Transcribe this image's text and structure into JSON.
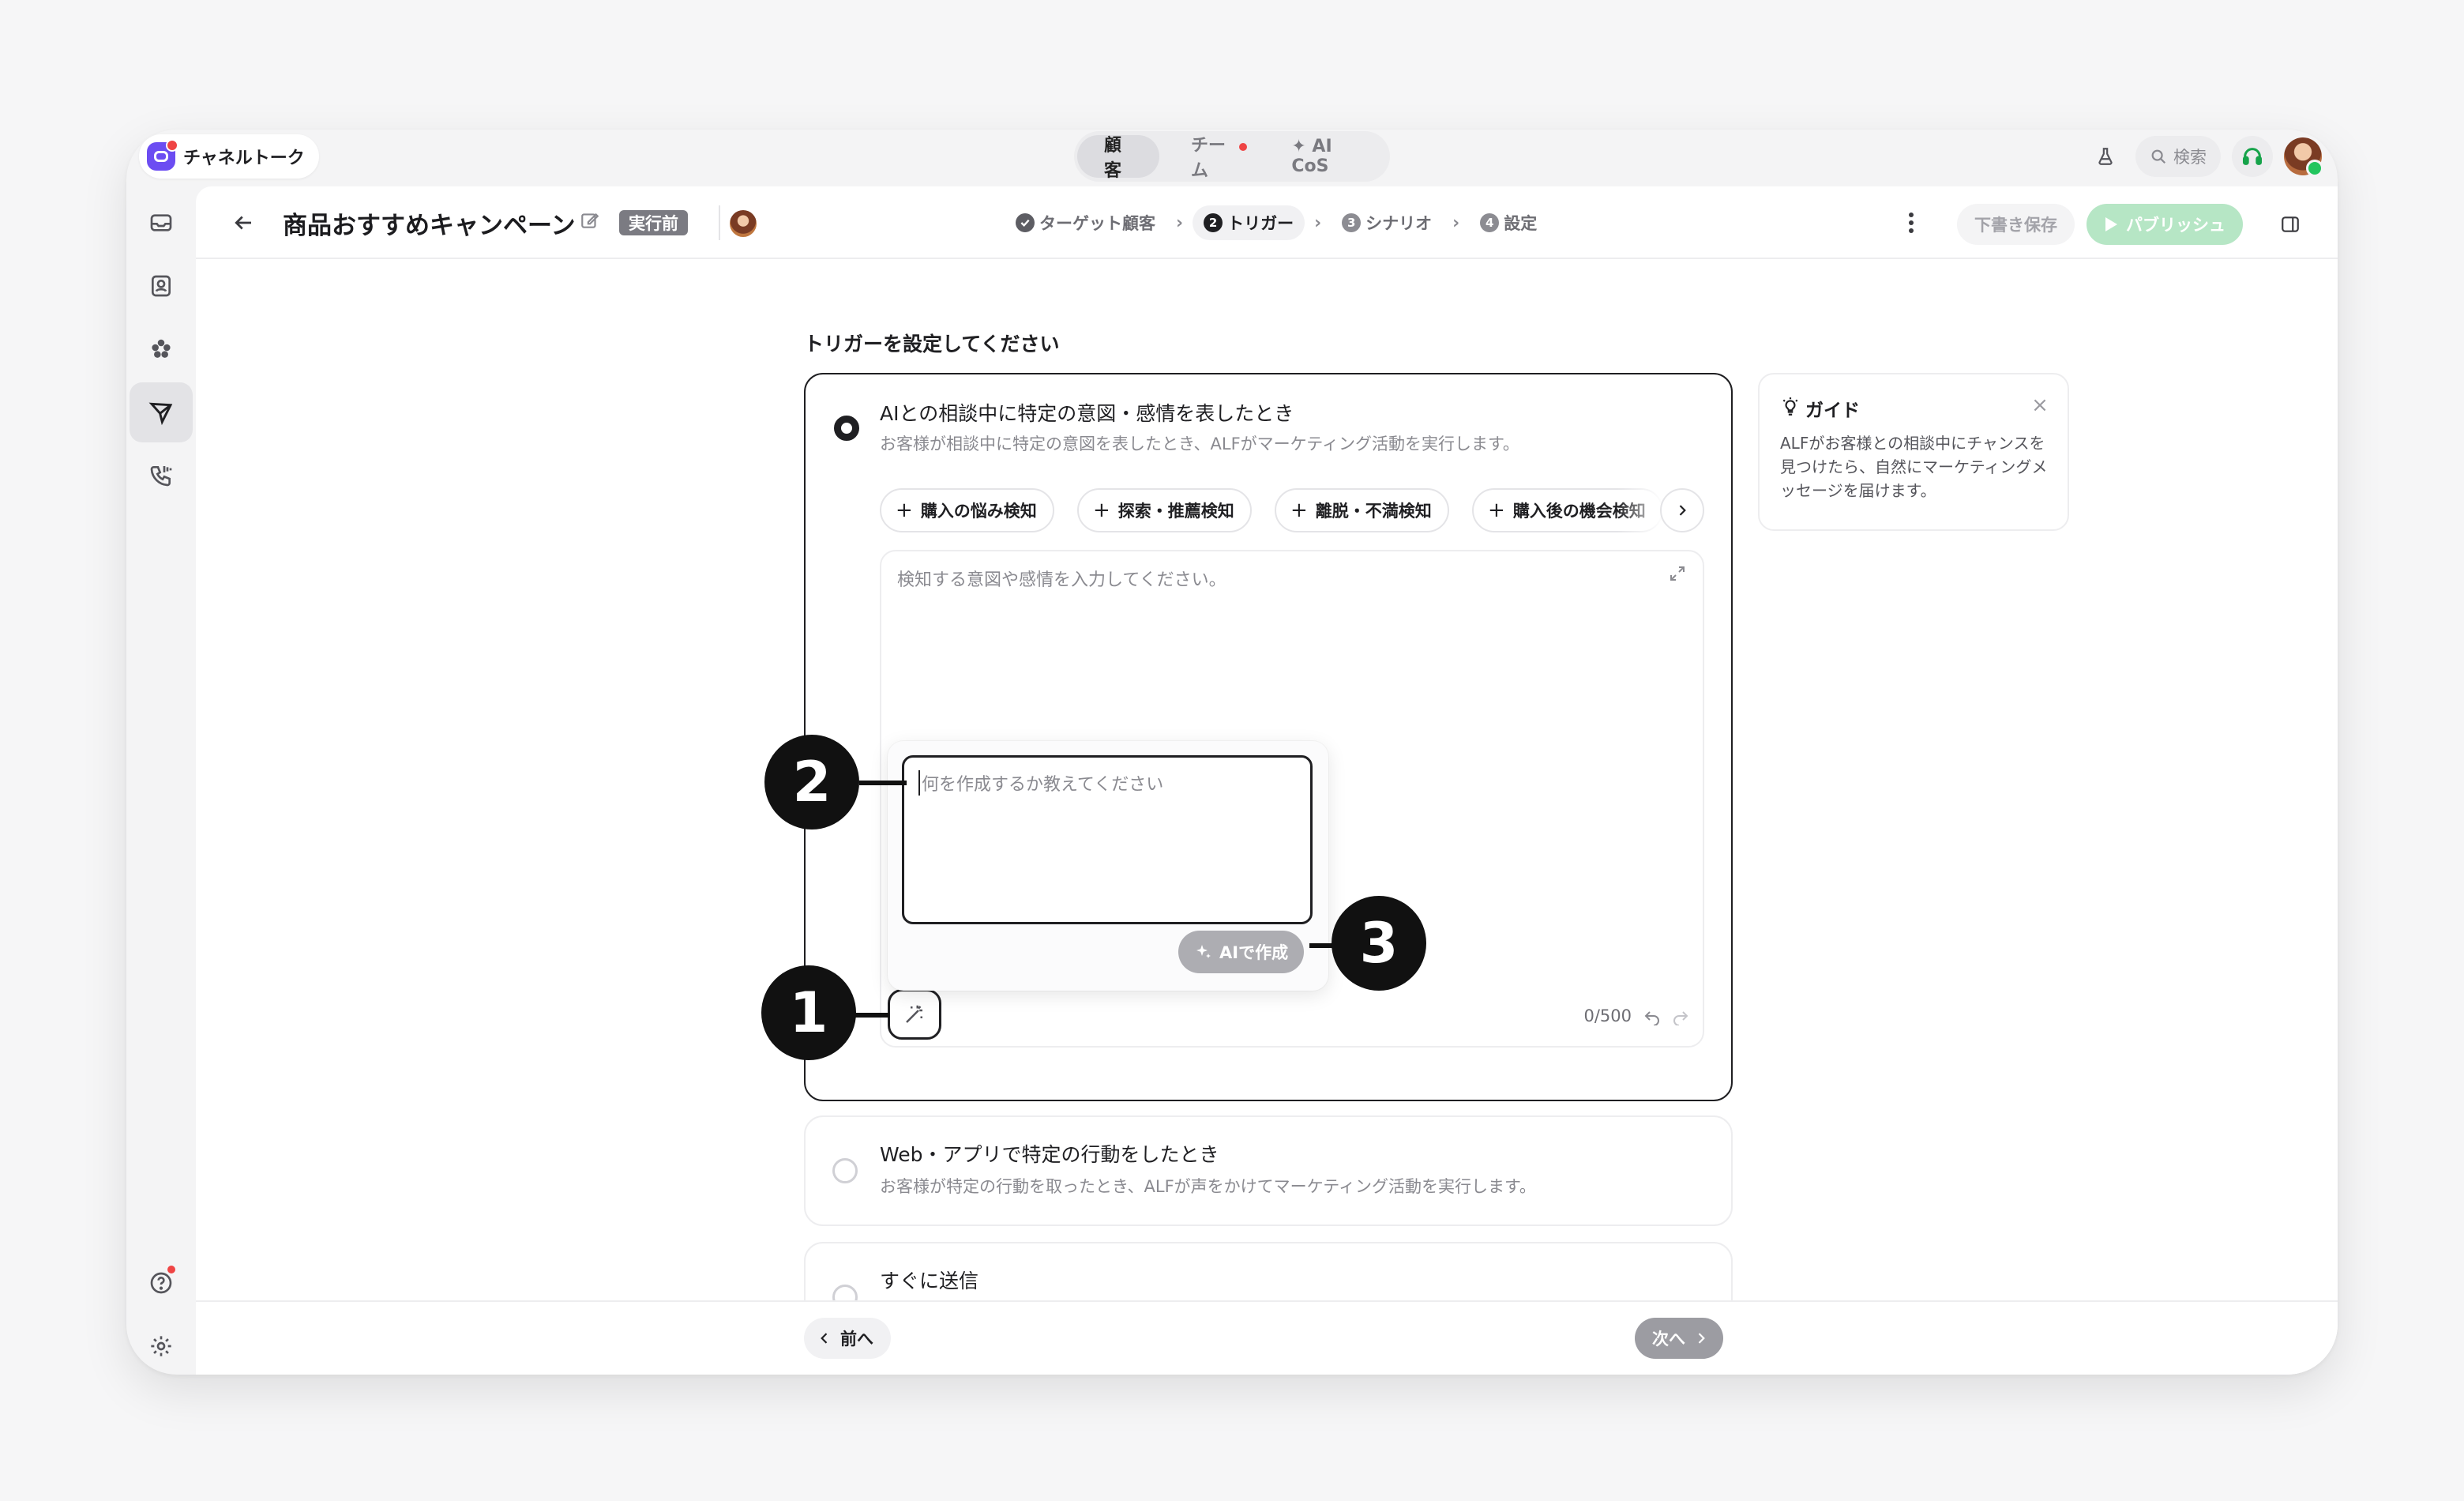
{
  "app": {
    "name": "チャネルトーク"
  },
  "top_tabs": [
    {
      "label": "顧客",
      "active": true
    },
    {
      "label": "チーム",
      "badge": true
    },
    {
      "label": "✦ AI CoS"
    }
  ],
  "top_right": {
    "search_label": "検索"
  },
  "header": {
    "title": "商品おすすめキャンペーン",
    "status": "実行前",
    "steps": [
      {
        "num": "",
        "label": "ターゲット顧客",
        "state": "done"
      },
      {
        "num": "2",
        "label": "トリガー",
        "state": "active"
      },
      {
        "num": "3",
        "label": "シナリオ",
        "state": "todo"
      },
      {
        "num": "4",
        "label": "設定",
        "state": "todo"
      }
    ],
    "draft_label": "下書き保存",
    "publish_label": "パブリッシュ"
  },
  "main": {
    "section_title": "トリガーを設定してください",
    "option1": {
      "title": "AIとの相談中に特定の意図・感情を表したとき",
      "desc": "お客様が相談中に特定の意図を表したとき、ALFがマーケティング活動を実行します。",
      "selected": true
    },
    "chips": [
      "購入の悩み検知",
      "探索・推薦検知",
      "離脱・不満検知",
      "購入後の機会検知"
    ],
    "editor": {
      "placeholder": "検知する意図や感情を入力してください。",
      "counter": "0/500"
    },
    "popup": {
      "placeholder": "何を作成するか教えてください",
      "generate_label": "AIで作成"
    },
    "option2": {
      "title": "Web・アプリで特定の行動をしたとき",
      "desc": "お客様が特定の行動を取ったとき、ALFが声をかけてマーケティング活動を実行します。"
    },
    "option3": {
      "title": "すぐに送信"
    }
  },
  "guide": {
    "title": "ガイド",
    "text": "ALFがお客様との相談中にチャンスを見つけたら、自然にマーケティングメッセージを届けます。"
  },
  "footer": {
    "prev_label": "前へ",
    "next_label": "次へ"
  },
  "callouts": [
    "1",
    "2",
    "3"
  ],
  "colors": {
    "brand": "#6c4df2",
    "publish": "#b6e6c5",
    "notification": "#ef4444",
    "online": "#22c55e"
  }
}
